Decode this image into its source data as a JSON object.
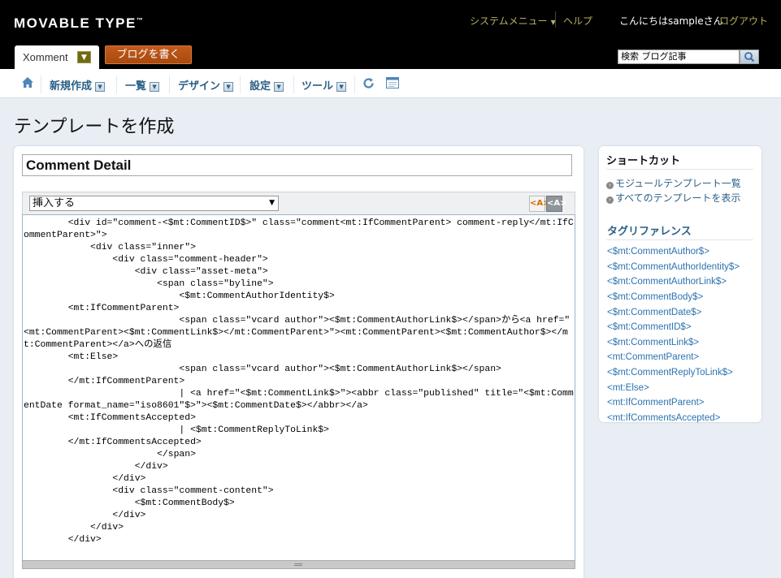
{
  "header": {
    "logo": "MOVABLE TYPE",
    "system_menu": "システムメニュー",
    "help": "ヘルプ",
    "greeting": "こんにちはsampleさん",
    "logout": "ログアウト",
    "blog_name": "Xomment",
    "write_button": "ブログを書く",
    "search_value": "検索 ブログ記事"
  },
  "nav": {
    "items": [
      {
        "label": "新規作成"
      },
      {
        "label": "一覧"
      },
      {
        "label": "デザイン"
      },
      {
        "label": "設定"
      },
      {
        "label": "ツール"
      }
    ]
  },
  "page": {
    "title": "テンプレートを作成",
    "template_name": "Comment Detail",
    "insert_select": "挿入する",
    "code": "        <div id=\"comment-<$mt:CommentID$>\" class=\"comment<mt:IfCommentParent> comment-reply</mt:IfCommentParent>\">\n            <div class=\"inner\">\n                <div class=\"comment-header\">\n                    <div class=\"asset-meta\">\n                        <span class=\"byline\">\n                            <$mt:CommentAuthorIdentity$>\n        <mt:IfCommentParent>\n                            <span class=\"vcard author\"><$mt:CommentAuthorLink$></span>から<a href=\"<mt:CommentParent><$mt:CommentLink$></mt:CommentParent>\"><mt:CommentParent><$mt:CommentAuthor$></mt:CommentParent></a>への返信\n        <mt:Else>\n                            <span class=\"vcard author\"><$mt:CommentAuthorLink$></span>\n        </mt:IfCommentParent>\n                            | <a href=\"<$mt:CommentLink$>\"><abbr class=\"published\" title=\"<$mt:CommentDate format_name=\"iso8601\"$>\"><$mt:CommentDate$></abbr></a>\n        <mt:IfCommentsAccepted>\n                            | <$mt:CommentReplyToLink$>\n        </mt:IfCommentsAccepted>\n                        </span>\n                    </div>\n                </div>\n                <div class=\"comment-content\">\n                    <$mt:CommentBody$>\n                </div>\n            </div>\n        </div>"
  },
  "sidebar": {
    "shortcuts_title": "ショートカット",
    "shortcuts": [
      {
        "label": "モジュールテンプレート一覧"
      },
      {
        "label": "すべてのテンプレートを表示"
      }
    ],
    "tagref_title": "タグリファレンス",
    "tags": [
      "<$mt:CommentAuthor$>",
      "<$mt:CommentAuthorIdentity$>",
      "<$mt:CommentAuthorLink$>",
      "<$mt:CommentBody$>",
      "<$mt:CommentDate$>",
      "<$mt:CommentID$>",
      "<$mt:CommentLink$>",
      "<mt:CommentParent>",
      "<$mt:CommentReplyToLink$>",
      "<mt:Else>",
      "<mt:IfCommentParent>",
      "<mt:IfCommentsAccepted>"
    ]
  },
  "colors": {
    "accent": "#2b5f86",
    "header_bg": "#000000",
    "menu_link": "#b8b060",
    "write_button": "#b8561a"
  }
}
